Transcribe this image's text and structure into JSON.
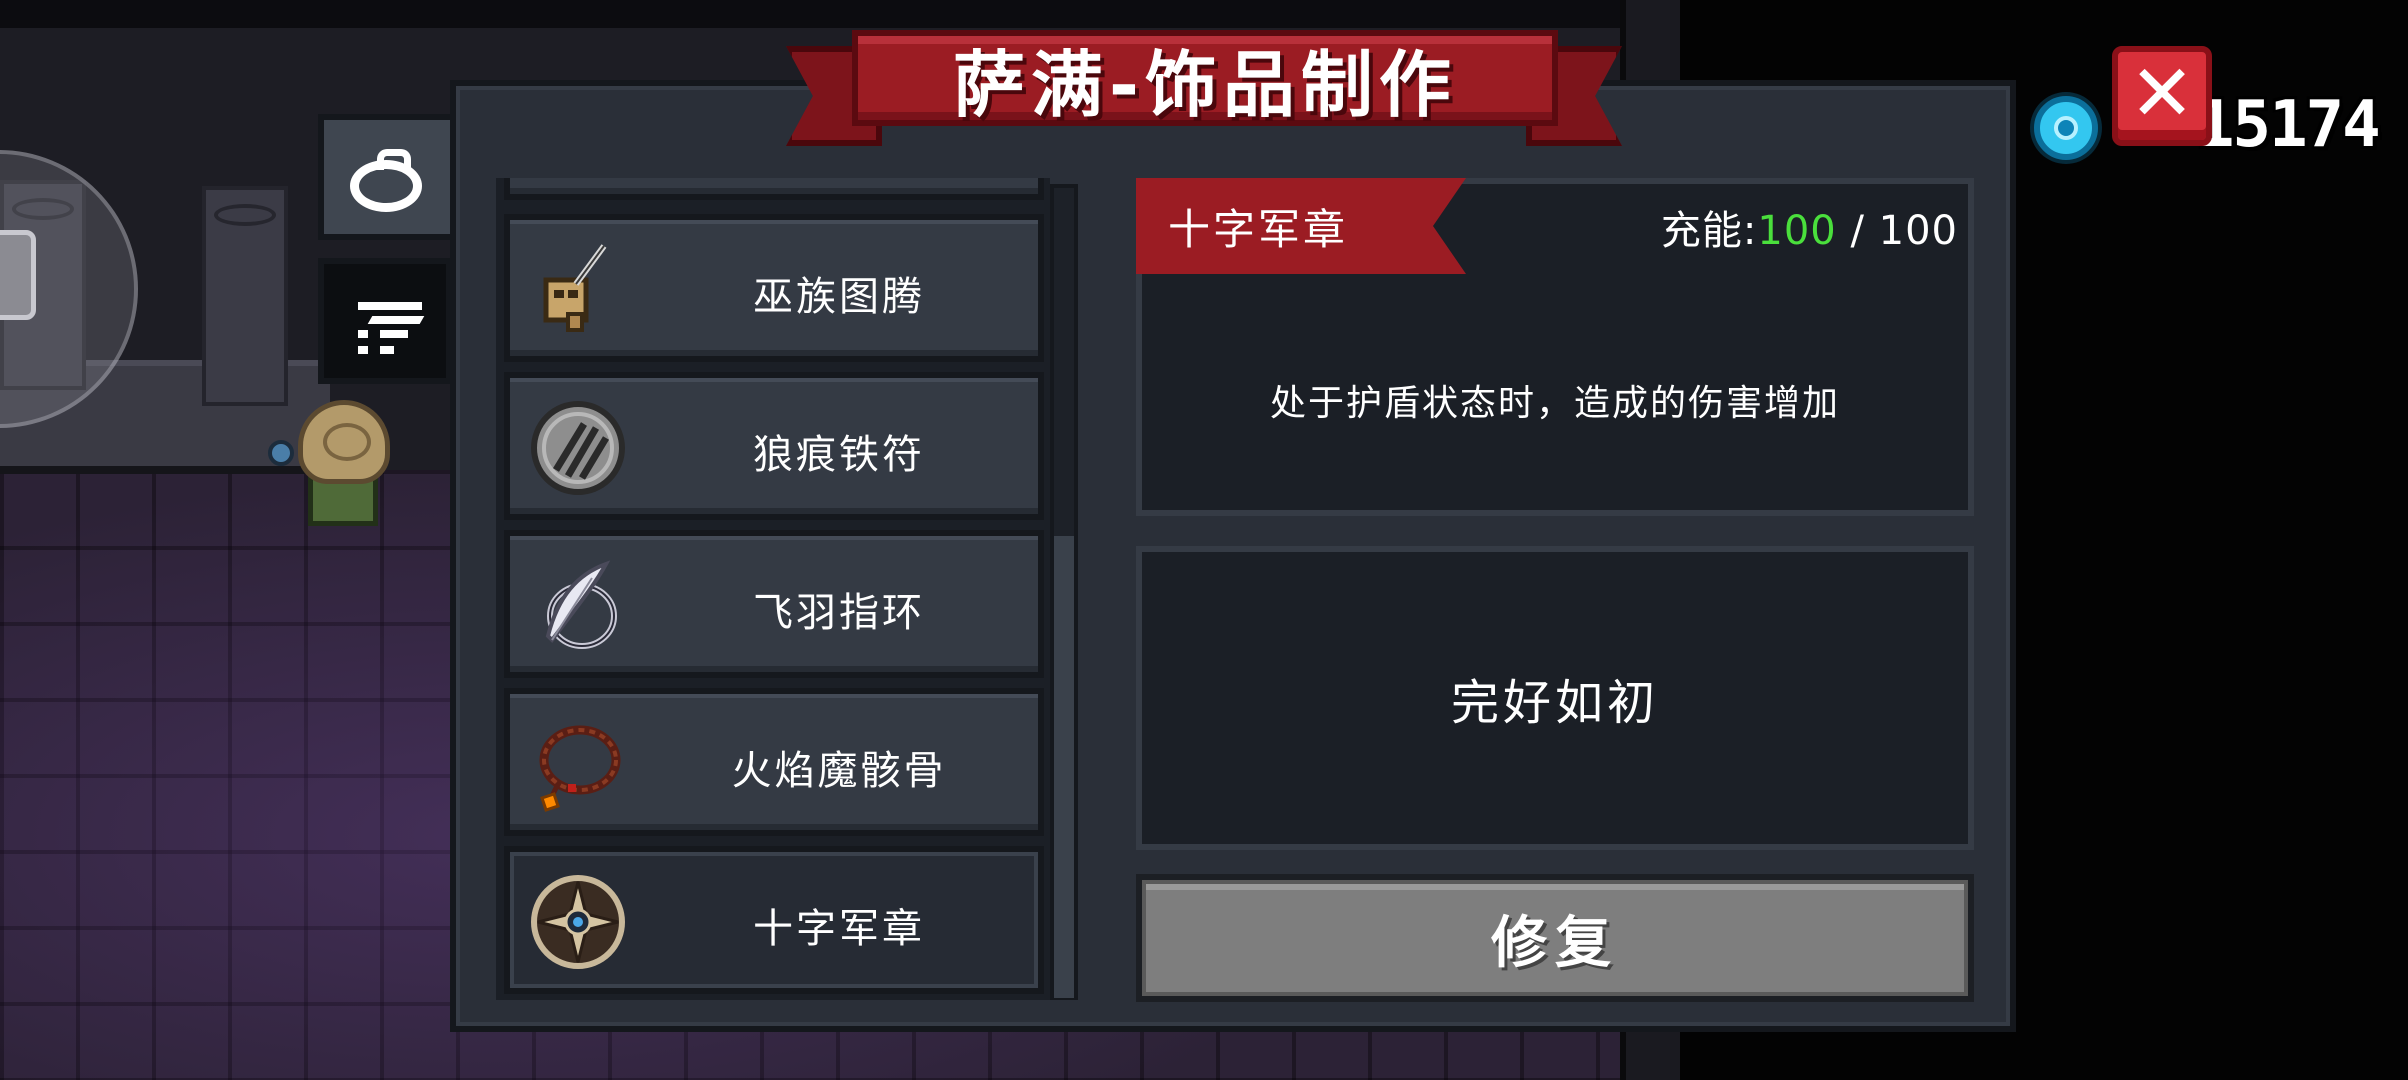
{
  "title": "萨满-饰品制作",
  "currency": {
    "icon": "gem-icon",
    "amount": "15174"
  },
  "close": {
    "label": "✕"
  },
  "tabs": [
    {
      "name": "accessory",
      "icon": "ring-icon",
      "active": true
    },
    {
      "name": "filter",
      "icon": "filter-icon",
      "active": false
    }
  ],
  "items": [
    {
      "label": "巫族图腾",
      "icon": "totem-icon"
    },
    {
      "label": "狼痕铁符",
      "icon": "wolf-claw-charm-icon"
    },
    {
      "label": "飞羽指环",
      "icon": "feather-ring-icon"
    },
    {
      "label": "火焰魔骸骨",
      "icon": "bead-necklace-icon"
    },
    {
      "label": "十字军章",
      "icon": "crusader-badge-icon",
      "selected": true
    }
  ],
  "detail": {
    "name": "十字军章",
    "charge_label": "充能:",
    "charge_current": "100",
    "charge_sep": " / ",
    "charge_max": "100",
    "effect": "处于护盾状态时，造成的伤害增加",
    "status": "完好如初",
    "repair_label": "修复"
  },
  "colors": {
    "banner": "#9b1c23",
    "charge_current": "#4adf3c",
    "repair_button": "#7e7e7e"
  }
}
